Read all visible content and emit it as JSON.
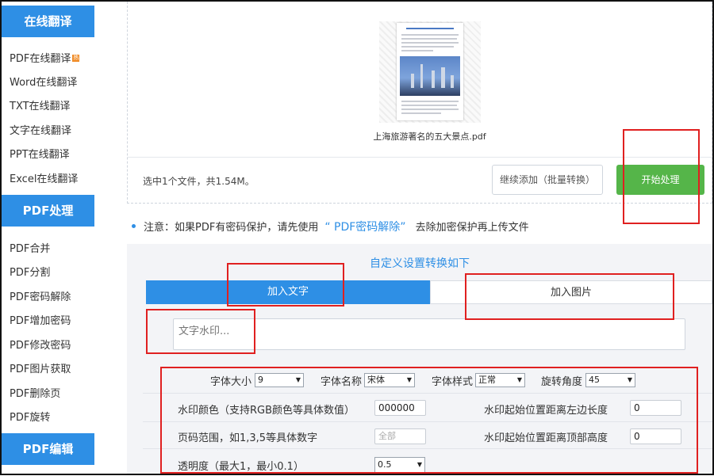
{
  "sidebar": {
    "online_translate": {
      "header": "在线翻译",
      "items": [
        "PDF在线翻译",
        "Word在线翻译",
        "TXT在线翻译",
        "文字在线翻译",
        "PPT在线翻译",
        "Excel在线翻译"
      ]
    },
    "pdf_process": {
      "header": "PDF处理",
      "items": [
        "PDF合并",
        "PDF分割",
        "PDF密码解除",
        "PDF增加密码",
        "PDF修改密码",
        "PDF图片获取",
        "PDF删除页",
        "PDF旋转"
      ]
    },
    "pdf_edit": {
      "header": "PDF编辑"
    }
  },
  "upload": {
    "file_name": "上海旅游著名的五大景点.pdf",
    "summary": "选中1个文件，共1.54M。",
    "continue_button": "继续添加（批量转换）",
    "start_button": "开始处理"
  },
  "notice": {
    "prefix": "注意：如果PDF有密码保护，请先使用",
    "link": "“ PDF密码解除”",
    "suffix": "去除加密保护再上传文件"
  },
  "settings": {
    "title": "自定义设置转换如下",
    "tabs": {
      "text": "加入文字",
      "image": "加入图片"
    },
    "watermark_placeholder": "文字水印...",
    "font_size_label": "字体大小",
    "font_size_value": "9",
    "font_name_label": "字体名称",
    "font_name_value": "宋体",
    "font_style_label": "字体样式",
    "font_style_value": "正常",
    "rotation_label": "旋转角度",
    "rotation_value": "45",
    "color_label": "水印颜色（支持RGB颜色等具体数值）",
    "color_value": "000000",
    "left_offset_label": "水印起始位置距离左边长度",
    "left_offset_value": "0",
    "page_range_label": "页码范围，如1,3,5等具体数字",
    "page_range_placeholder": "全部",
    "top_offset_label": "水印起始位置距离顶部高度",
    "top_offset_value": "0",
    "opacity_label": "透明度（最大1，最小0.1）",
    "opacity_value": "0.5"
  },
  "colors": {
    "accent": "#2e8fe5",
    "start_green": "#55b549",
    "annotation_red": "#e02020",
    "panel_bg": "#f3f4f7"
  }
}
